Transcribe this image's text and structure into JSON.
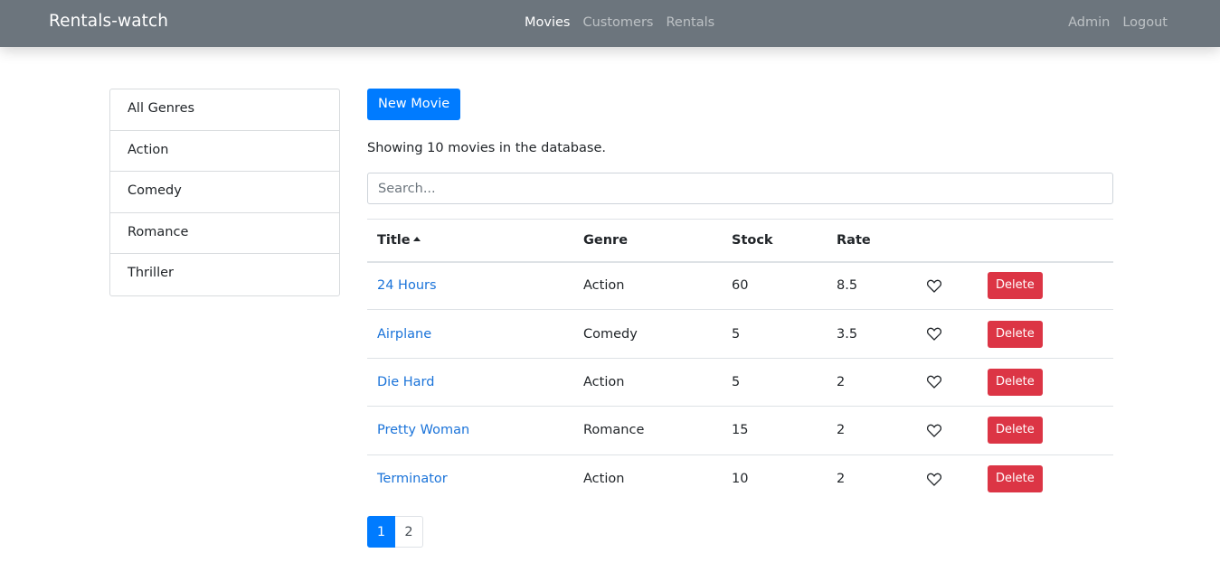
{
  "navbar": {
    "brand": "Rentals-watch",
    "links": [
      {
        "label": "Movies",
        "active": true
      },
      {
        "label": "Customers",
        "active": false
      },
      {
        "label": "Rentals",
        "active": false
      }
    ],
    "right_links": [
      {
        "label": "Admin"
      },
      {
        "label": "Logout"
      }
    ],
    "background_color": "#6c757d"
  },
  "sidebar": {
    "genres": [
      {
        "label": "All Genres"
      },
      {
        "label": "Action"
      },
      {
        "label": "Comedy"
      },
      {
        "label": "Romance"
      },
      {
        "label": "Thriller"
      }
    ]
  },
  "main": {
    "new_movie_label": "New Movie",
    "count_text": "Showing 10 movies in the database.",
    "search": {
      "placeholder": "Search...",
      "value": ""
    },
    "table": {
      "headers": {
        "title": "Title",
        "genre": "Genre",
        "stock": "Stock",
        "rate": "Rate"
      },
      "sort_column": "title",
      "sort_order": "asc",
      "rows": [
        {
          "title": "24 Hours",
          "genre": "Action",
          "stock": "60",
          "rate": "8.5",
          "delete_label": "Delete"
        },
        {
          "title": "Airplane",
          "genre": "Comedy",
          "stock": "5",
          "rate": "3.5",
          "delete_label": "Delete"
        },
        {
          "title": "Die Hard",
          "genre": "Action",
          "stock": "5",
          "rate": "2",
          "delete_label": "Delete"
        },
        {
          "title": "Pretty Woman",
          "genre": "Romance",
          "stock": "15",
          "rate": "2",
          "delete_label": "Delete"
        },
        {
          "title": "Terminator",
          "genre": "Action",
          "stock": "10",
          "rate": "2",
          "delete_label": "Delete"
        }
      ]
    },
    "pagination": {
      "pages": [
        "1",
        "2"
      ],
      "current": "1"
    },
    "colors": {
      "primary": "#007bff",
      "danger": "#dc3545",
      "link": "#1a73d9"
    }
  }
}
